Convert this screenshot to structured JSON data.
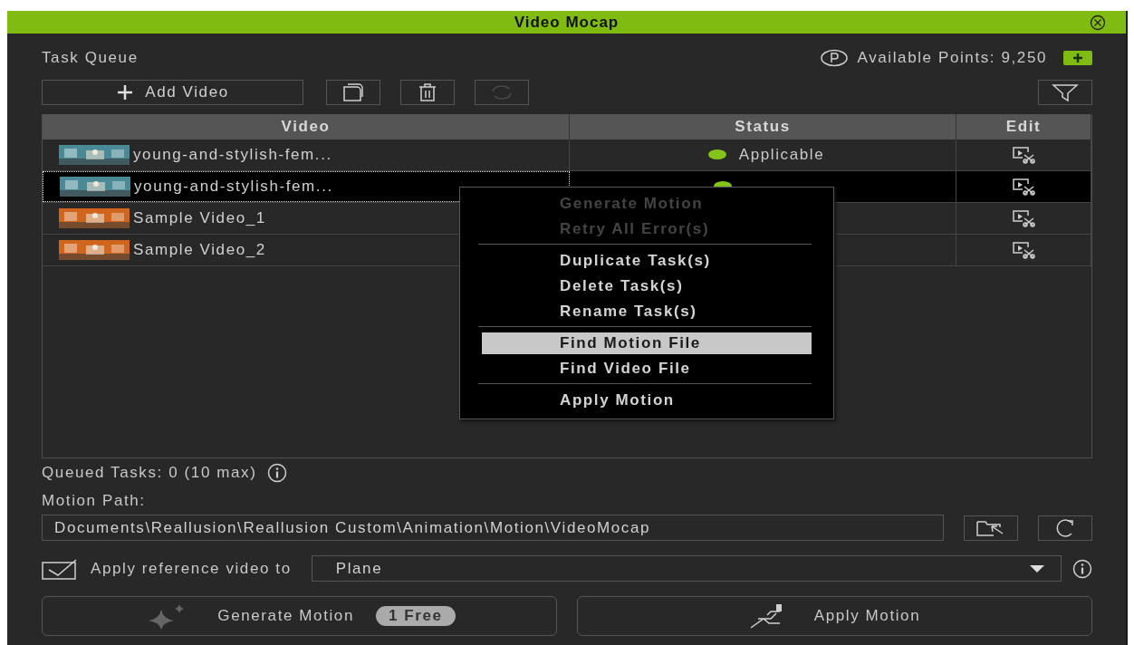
{
  "window": {
    "title": "Video Mocap"
  },
  "task_queue": {
    "label": "Task Queue",
    "points": "Available Points: 9,250"
  },
  "toolbar": {
    "add_label": "Add Video",
    "retry_disabled": true
  },
  "table": {
    "columns": [
      "Video",
      "Status",
      "Edit"
    ],
    "rows": [
      {
        "name": "young-and-stylish-fem...",
        "status": "Applicable",
        "color": "#84c41a",
        "selected": false
      },
      {
        "name": "young-and-stylish-fem...",
        "color": "#84c41a",
        "selected": true
      },
      {
        "name": "Sample Video_1",
        "selected": false
      },
      {
        "name": "Sample Video_2",
        "selected": false
      }
    ]
  },
  "context_menu": [
    {
      "kind": "item",
      "label": "Generate Motion",
      "disabled": true,
      "selected": false
    },
    {
      "kind": "item",
      "label": "Retry All Error(s)",
      "disabled": true,
      "selected": false
    },
    {
      "kind": "separator"
    },
    {
      "kind": "item",
      "label": "Duplicate Task(s)",
      "disabled": false,
      "selected": false
    },
    {
      "kind": "item",
      "label": "Delete Task(s)",
      "disabled": false,
      "selected": false
    },
    {
      "kind": "item",
      "label": "Rename Task(s)",
      "disabled": false,
      "selected": false
    },
    {
      "kind": "separator"
    },
    {
      "kind": "item",
      "label": "Find Motion File",
      "disabled": false,
      "selected": true
    },
    {
      "kind": "item",
      "label": "Find Video File",
      "disabled": false,
      "selected": false
    },
    {
      "kind": "separator"
    },
    {
      "kind": "item",
      "label": "Apply Motion",
      "disabled": false,
      "selected": false
    }
  ],
  "queued_tasks": "Queued Tasks: 0 (10 max)",
  "motion_path": {
    "label": "Motion Path:",
    "value": "Documents\\Reallusion\\Reallusion Custom\\Animation\\Motion\\VideoMocap"
  },
  "apply_reference": {
    "label": "Apply reference video to",
    "checked": true,
    "value": "Plane"
  },
  "generate_button": {
    "label": "Generate Motion",
    "badge": "1 Free"
  },
  "apply_button": {
    "label": "Apply Motion"
  }
}
